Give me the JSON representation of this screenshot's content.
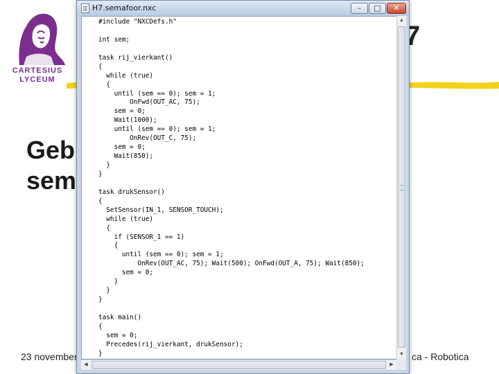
{
  "slide": {
    "logo_line1": "CARTESIUS",
    "logo_line2": "LYCEUM",
    "title_fragment": "7",
    "body_line1": "Geb",
    "body_line2": "sem",
    "footer_left": "23 november",
    "footer_right": "ca - Robotica",
    "accent_color": "#7b2e8e",
    "highlight_color": "#f2d21b"
  },
  "window": {
    "title": "H7.semafoor.nxc",
    "buttons": {
      "minimize": "–",
      "maximize": "□",
      "close": "✕"
    }
  },
  "code_lines": [
    "#include \"NXCDefs.h\"",
    "",
    "int sem;",
    "",
    "task rij_vierkant()",
    "{",
    "  while (true)",
    "  {",
    "    until (sem == 0); sem = 1;",
    "        OnFwd(OUT_AC, 75);",
    "    sem = 0;",
    "    Wait(1000);",
    "    until (sem == 0); sem = 1;",
    "        OnRev(OUT_C, 75);",
    "    sem = 0;",
    "    Wait(850);",
    "  }",
    "}",
    "",
    "task drukSensor()",
    "{",
    "  SetSensor(IN_1, SENSOR_TOUCH);",
    "  while (true)",
    "  {",
    "    if (SENSOR_1 == 1)",
    "    {",
    "      until (sem == 0); sem = 1;",
    "          OnRev(OUT_AC, 75); Wait(500); OnFwd(OUT_A, 75); Wait(850);",
    "      sem = 0;",
    "    }",
    "  }",
    "}",
    "",
    "task main()",
    "{",
    "  sem = 0;",
    "  Precedes(rij_vierkant, drukSensor);",
    "}"
  ],
  "icons": {
    "file": "document-icon",
    "scroll_up": "scroll-up-arrow-icon",
    "scroll_down": "scroll-down-arrow-icon",
    "scroll_left": "scroll-left-arrow-icon",
    "scroll_right": "scroll-right-arrow-icon"
  }
}
